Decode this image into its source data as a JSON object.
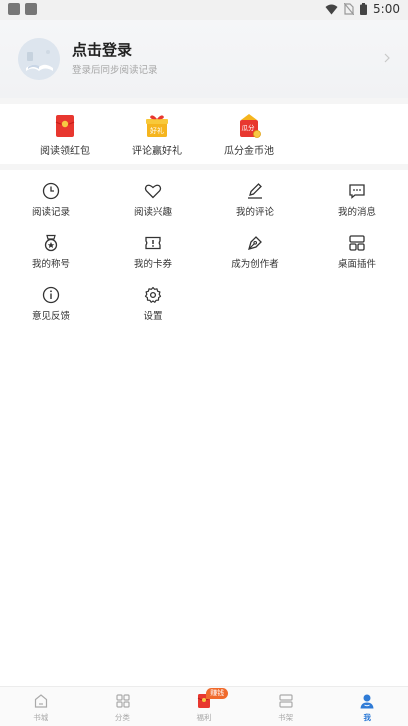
{
  "status_bar": {
    "time": "5:00"
  },
  "profile": {
    "title": "点击登录",
    "subtitle": "登录后同步阅读记录"
  },
  "features": [
    {
      "label": "阅读领红包",
      "icon": "red-envelope-icon"
    },
    {
      "label": "评论赢好礼",
      "icon": "gift-icon",
      "icon_text": "好礼"
    },
    {
      "label": "瓜分金币池",
      "icon": "coin-pool-icon",
      "icon_text": "瓜分"
    }
  ],
  "menu": [
    {
      "label": "阅读记录",
      "icon": "clock-icon"
    },
    {
      "label": "阅读兴趣",
      "icon": "heart-icon"
    },
    {
      "label": "我的评论",
      "icon": "pencil-icon"
    },
    {
      "label": "我的消息",
      "icon": "message-icon"
    },
    {
      "label": "我的称号",
      "icon": "medal-icon"
    },
    {
      "label": "我的卡券",
      "icon": "coupon-icon"
    },
    {
      "label": "成为创作者",
      "icon": "pen-nib-icon"
    },
    {
      "label": "桌面插件",
      "icon": "widget-icon"
    },
    {
      "label": "意见反馈",
      "icon": "info-icon"
    },
    {
      "label": "设置",
      "icon": "gear-icon"
    }
  ],
  "tabbar": {
    "items": [
      {
        "label": "书城",
        "icon": "home-icon"
      },
      {
        "label": "分类",
        "icon": "grid-icon"
      },
      {
        "label": "福利",
        "icon": "red-packet-icon",
        "badge": "赚钱"
      },
      {
        "label": "书架",
        "icon": "bookshelf-icon"
      },
      {
        "label": "我",
        "icon": "person-icon",
        "active": true
      }
    ]
  },
  "colors": {
    "accent": "#2f7bd6",
    "badge": "#f06a2c",
    "red": "#e8372f",
    "gold": "#f5b51e"
  }
}
